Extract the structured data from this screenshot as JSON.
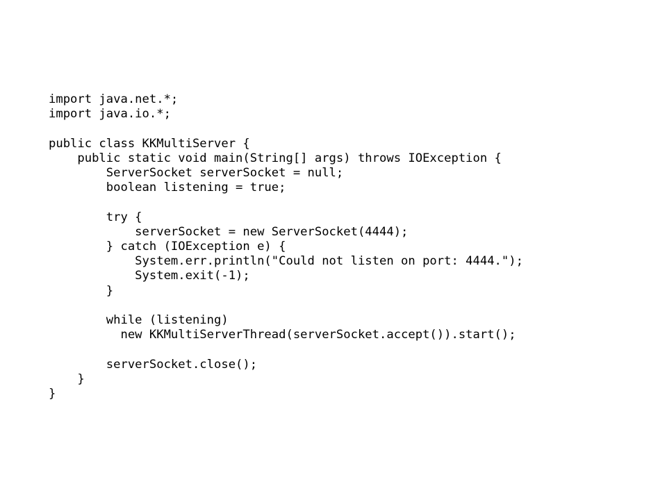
{
  "slide": {
    "background_color": "#ffffff",
    "text_color": "#000000",
    "language": "java",
    "class_name": "KKMultiServer",
    "port": "4444"
  },
  "code": {
    "full_text": "import java.net.*;\nimport java.io.*;\n\npublic class KKMultiServer {\n    public static void main(String[] args) throws IOException {\n        ServerSocket serverSocket = null;\n        boolean listening = true;\n\n        try {\n            serverSocket = new ServerSocket(4444);\n        } catch (IOException e) {\n            System.err.println(\"Could not listen on port: 4444.\");\n            System.exit(-1);\n        }\n\n        while (listening)\n          new KKMultiServerThread(serverSocket.accept()).start();\n\n        serverSocket.close();\n    }\n}",
    "lines": [
      "import java.net.*;",
      "import java.io.*;",
      "",
      "public class KKMultiServer {",
      "    public static void main(String[] args) throws IOException {",
      "        ServerSocket serverSocket = null;",
      "        boolean listening = true;",
      "",
      "        try {",
      "            serverSocket = new ServerSocket(4444);",
      "        } catch (IOException e) {",
      "            System.err.println(\"Could not listen on port: 4444.\");",
      "            System.exit(-1);",
      "        }",
      "",
      "        while (listening)",
      "          new KKMultiServerThread(serverSocket.accept()).start();",
      "",
      "        serverSocket.close();",
      "    }",
      "}"
    ]
  }
}
